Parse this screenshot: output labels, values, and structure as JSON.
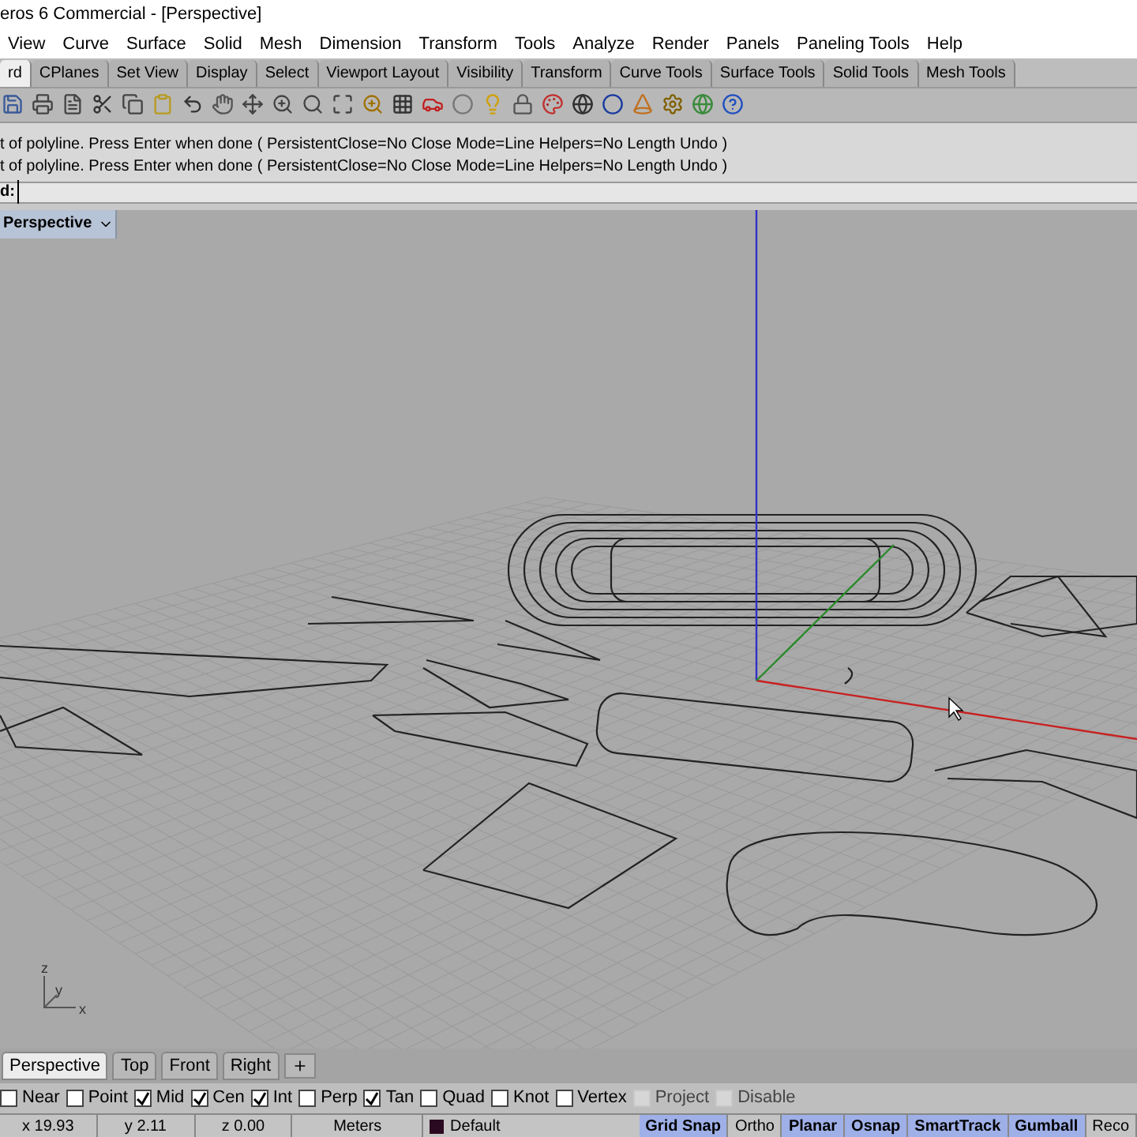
{
  "window": {
    "title": "eros 6 Commercial - [Perspective]"
  },
  "menu": [
    "View",
    "Curve",
    "Surface",
    "Solid",
    "Mesh",
    "Dimension",
    "Transform",
    "Tools",
    "Analyze",
    "Render",
    "Panels",
    "Paneling Tools",
    "Help"
  ],
  "toolbar_tabs": [
    {
      "label": "rd",
      "selected": true
    },
    {
      "label": "CPlanes",
      "selected": false
    },
    {
      "label": "Set View",
      "selected": false
    },
    {
      "label": "Display",
      "selected": false
    },
    {
      "label": "Select",
      "selected": false
    },
    {
      "label": "Viewport Layout",
      "selected": false
    },
    {
      "label": "Visibility",
      "selected": false
    },
    {
      "label": "Transform",
      "selected": false
    },
    {
      "label": "Curve Tools",
      "selected": false
    },
    {
      "label": "Surface Tools",
      "selected": false
    },
    {
      "label": "Solid Tools",
      "selected": false
    },
    {
      "label": "Mesh Tools",
      "selected": false
    }
  ],
  "command_history": [
    "t of polyline. Press Enter when done ( PersistentClose=No  Close  Mode=Line  Helpers=No  Length  Undo )",
    "t of polyline. Press Enter when done ( PersistentClose=No  Close  Mode=Line  Helpers=No  Length  Undo )"
  ],
  "command_prompt": "d:",
  "viewport": {
    "title": "Perspective",
    "axis_labels": [
      "z",
      "y",
      "x"
    ]
  },
  "viewport_tabs": [
    {
      "label": "Perspective",
      "selected": true
    },
    {
      "label": "Top",
      "selected": false
    },
    {
      "label": "Front",
      "selected": false
    },
    {
      "label": "Right",
      "selected": false
    }
  ],
  "osnaps": [
    {
      "label": "Near",
      "checked": false,
      "disabled": false
    },
    {
      "label": "Point",
      "checked": false,
      "disabled": false
    },
    {
      "label": "Mid",
      "checked": true,
      "disabled": false
    },
    {
      "label": "Cen",
      "checked": true,
      "disabled": false
    },
    {
      "label": "Int",
      "checked": true,
      "disabled": false
    },
    {
      "label": "Perp",
      "checked": false,
      "disabled": false
    },
    {
      "label": "Tan",
      "checked": true,
      "disabled": false
    },
    {
      "label": "Quad",
      "checked": false,
      "disabled": false
    },
    {
      "label": "Knot",
      "checked": false,
      "disabled": false
    },
    {
      "label": "Vertex",
      "checked": false,
      "disabled": false
    },
    {
      "label": "Project",
      "checked": false,
      "disabled": true
    },
    {
      "label": "Disable",
      "checked": false,
      "disabled": true
    }
  ],
  "status_bar": {
    "coordinates": [
      "x 19.93",
      "y 2.11",
      "z 0.00"
    ],
    "units": "Meters",
    "layer": {
      "name": "Default",
      "color": "#2a0a20"
    },
    "toggles": [
      {
        "label": "Grid Snap",
        "on": true
      },
      {
        "label": "Ortho",
        "on": false
      },
      {
        "label": "Planar",
        "on": true
      },
      {
        "label": "Osnap",
        "on": true
      },
      {
        "label": "SmartTrack",
        "on": true
      },
      {
        "label": "Gumball",
        "on": true
      },
      {
        "label": "Reco",
        "on": false
      }
    ]
  }
}
